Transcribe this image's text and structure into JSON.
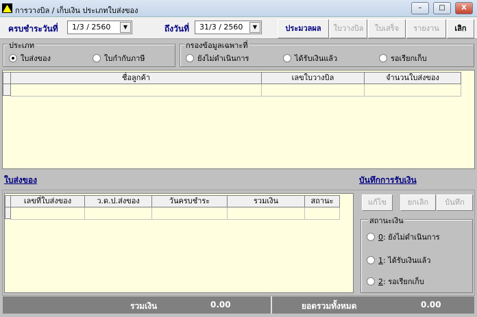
{
  "window": {
    "title": "การวางบิล / เก็บเงิน  ประเภทใบส่งของ",
    "minimize": "–",
    "maximize": "□",
    "close": "X"
  },
  "toolbar": {
    "due_from_label": "ครบชำระวันที่",
    "due_from_value": "1/3 / 2560",
    "to_label": "ถึงวันที่",
    "to_value": "31/3 / 2560",
    "buttons": [
      "ประมวลผล",
      "ใบวางบิล",
      "ใบเสร็จ",
      "รายงาน",
      "เลิก"
    ]
  },
  "type_group": {
    "title": "ประเภท",
    "options": [
      "ใบส่งของ",
      "ใบกำกับภาษี"
    ],
    "selected": 0
  },
  "filter_group": {
    "title": "กรองข้อมูลเฉพาะที่",
    "options": [
      "ยังไม่ดำเนินการ",
      "ได้รับเงินแล้ว",
      "รอเรียกเก็บ"
    ]
  },
  "customer_grid": {
    "columns": [
      "ชื่อลูกค้า",
      "เลขใบวางบิล",
      "จำนวนใบส่งของ"
    ]
  },
  "links": {
    "delivery": "ใบส่งของ",
    "record_payment": "บันทึกการรับเงิน"
  },
  "delivery_grid": {
    "columns": [
      "เลขที่ใบส่งของ",
      "ว.ด.ป.ส่งของ",
      "วันครบชำระ",
      "รวมเงิน",
      "สถานะ"
    ]
  },
  "actions": [
    "แก้ไข",
    "ยกเลิก",
    "บันทึก"
  ],
  "money_status": {
    "title": "สถานะเงิน",
    "options": [
      {
        "key": "0",
        "label": ": ยังไม่ดำเนินการ"
      },
      {
        "key": "1",
        "label": ": ได้รับเงินแล้ว"
      },
      {
        "key": "2",
        "label": ": รอเรียกเก็บ"
      }
    ]
  },
  "footer": {
    "sum_label": "รวมเงิน",
    "sum_value": "0.00",
    "total_label": "ยอดรวมทั้งหมด",
    "total_value": "0.00"
  }
}
